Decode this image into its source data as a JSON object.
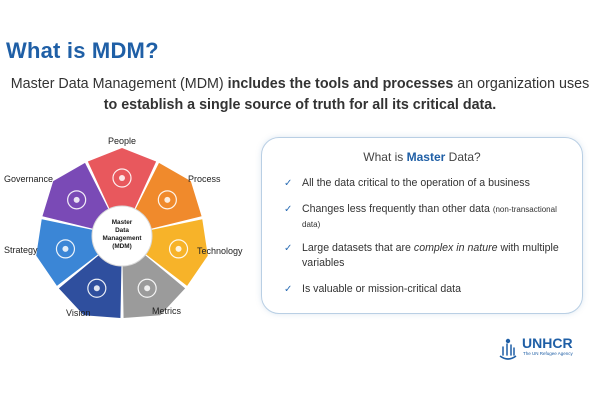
{
  "title": "What is MDM?",
  "intro": {
    "part1": "Master Data Management (MDM) ",
    "part2": "includes the tools and processes",
    "part3": " an organization uses ",
    "part4": "to establish a single source of truth for all its critical data."
  },
  "diagram": {
    "center": [
      "Master",
      "Data",
      "Management",
      "(MDM)"
    ],
    "segments": [
      {
        "label": "People",
        "color": "#e8585d",
        "icon": "people-icon"
      },
      {
        "label": "Process",
        "color": "#f08a2c",
        "icon": "gears-icon"
      },
      {
        "label": "Technology",
        "color": "#f7b329",
        "icon": "cloud-icon"
      },
      {
        "label": "Metrics",
        "color": "#9b9b9b",
        "icon": "chart-icon"
      },
      {
        "label": "Vision",
        "color": "#2f4f9e",
        "icon": "person-icon"
      },
      {
        "label": "Strategy",
        "color": "#3b86d6",
        "icon": "target-icon"
      },
      {
        "label": "Governance",
        "color": "#7a4ab6",
        "icon": "building-icon"
      }
    ]
  },
  "card": {
    "title_prefix": "What is ",
    "title_bold": "Master",
    "title_suffix": " Data?",
    "bullets": [
      {
        "text": "All the data critical to the operation of a business"
      },
      {
        "text": "Changes less frequently than other data ",
        "small": "(non-transactional data)"
      },
      {
        "pre": "Large datasets that are ",
        "em": "complex in nature",
        "post": " with multiple variables"
      },
      {
        "text": "Is valuable or mission-critical data"
      }
    ]
  },
  "logo": {
    "word": "UNHCR",
    "tagline": "The UN Refugee Agency",
    "icon": "unhcr-emblem-icon"
  },
  "colors": {
    "accent": "#1f5fa6",
    "card_border": "#b9cfe4",
    "check": "#2e6fb5"
  }
}
